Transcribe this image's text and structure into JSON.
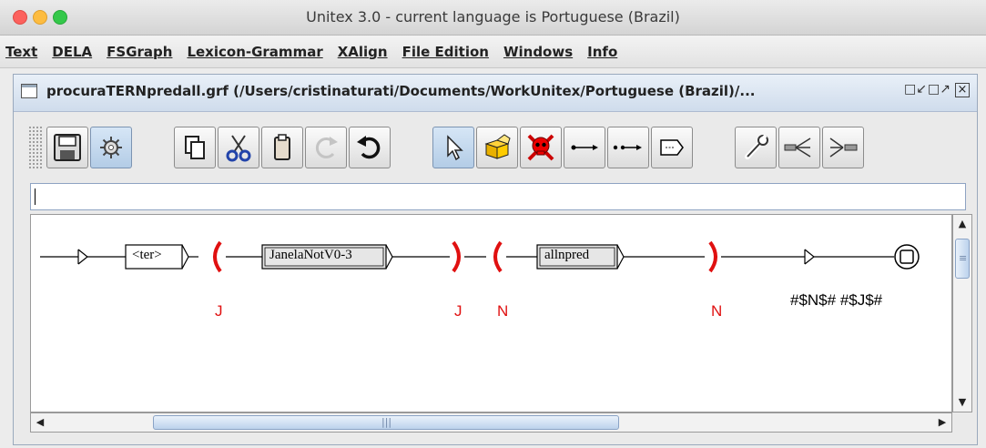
{
  "window": {
    "title": "Unitex 3.0 - current language is Portuguese (Brazil)"
  },
  "menu": [
    "Text",
    "DELA",
    "FSGraph",
    "Lexicon-Grammar",
    "XAlign",
    "File Edition",
    "Windows",
    "Info"
  ],
  "document": {
    "title": "procuraTERNpredall.grf (/Users/cristinaturati/Documents/WorkUnitex/Portuguese (Brazil)/...",
    "controls": {
      "iconify": "□↙",
      "maximize": "□↗",
      "close": "☒"
    }
  },
  "toolbar": {
    "buttons": [
      {
        "name": "save",
        "icon": "floppy-icon"
      },
      {
        "name": "compile",
        "icon": "gear-icon",
        "selected": true
      },
      {
        "name": "copy",
        "icon": "copy-icon"
      },
      {
        "name": "cut",
        "icon": "scissors-icon"
      },
      {
        "name": "paste",
        "icon": "clipboard-icon"
      },
      {
        "name": "redo",
        "icon": "redo-icon"
      },
      {
        "name": "undo",
        "icon": "undo-icon"
      },
      {
        "name": "select",
        "icon": "arrow-cursor-icon",
        "selected": true
      },
      {
        "name": "open-subgraph",
        "icon": "box-icon"
      },
      {
        "name": "delete",
        "icon": "skull-icon"
      },
      {
        "name": "transition",
        "icon": "transition-icon"
      },
      {
        "name": "reverse-transition",
        "icon": "reverse-transition-icon"
      },
      {
        "name": "comment",
        "icon": "comment-box-icon"
      },
      {
        "name": "configure",
        "icon": "wrench-icon"
      },
      {
        "name": "export",
        "icon": "fork-out-icon"
      },
      {
        "name": "import",
        "icon": "fork-in-icon"
      }
    ]
  },
  "box_text_input": {
    "value": ""
  },
  "graph": {
    "boxes": {
      "ter": "<ter>",
      "janela": "JanelaNotV0-3",
      "allnpred": "allnpred"
    },
    "outputs": {
      "j_open": "J",
      "j_close": "J",
      "n_open": "N",
      "n_close": "N",
      "final": "#$N$# #$J$#"
    },
    "colors": {
      "context": "#e01010",
      "text": "#000000"
    }
  },
  "scrollbars": {
    "up": "▲",
    "down": "▼",
    "left": "◀",
    "right": "▶"
  }
}
